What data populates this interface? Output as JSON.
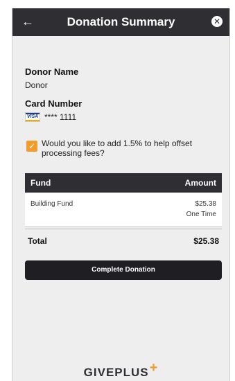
{
  "header": {
    "title": "Donation Summary",
    "back_icon": "arrow-left-icon",
    "close_icon": "close-icon"
  },
  "donor": {
    "label": "Donor Name",
    "value": "Donor"
  },
  "card": {
    "label": "Card Number",
    "brand": "VISA",
    "number": "**** 1111"
  },
  "fee_option": {
    "checked": true,
    "text": "Would you like to add 1.5% to help offset processing fees?"
  },
  "table": {
    "columns": [
      "Fund",
      "Amount"
    ],
    "rows": [
      {
        "fund": "Building Fund",
        "amount": "$25.38",
        "frequency": "One Time"
      }
    ]
  },
  "total": {
    "label": "Total",
    "amount": "$25.38"
  },
  "actions": {
    "complete_label": "Complete Donation"
  },
  "branding": {
    "logo_text": "GIVEPLUS",
    "logo_mark": "+"
  },
  "colors": {
    "header_bg": "#2f2f33",
    "accent": "#f39c2a",
    "screen_bg": "#eeeeee"
  }
}
